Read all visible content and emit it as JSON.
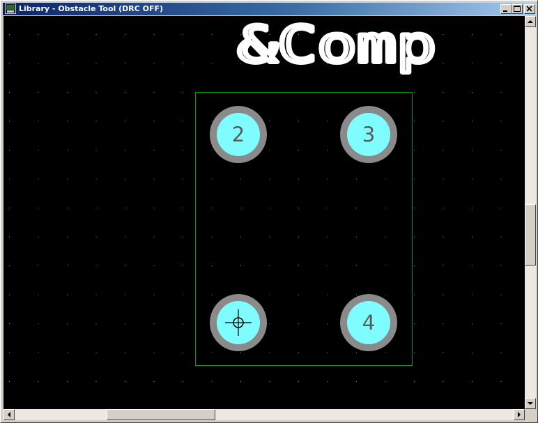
{
  "window": {
    "title": "Library - Obstacle Tool (DRC OFF)"
  },
  "canvas": {
    "colors": {
      "background": "#000000",
      "grid_dot": "#8a8a8a",
      "outline": "#00a000",
      "silkscreen": "#ffffff",
      "pad_fill": "#7ffcff",
      "pad_ring": "#8a8a8a",
      "pad_label": "#5a5a5a"
    },
    "ref_designator": "&Comp",
    "pads": [
      {
        "label": "2"
      },
      {
        "label": "3"
      },
      {
        "label": ""
      },
      {
        "label": "4"
      }
    ]
  },
  "icons": {
    "app": "library-icon",
    "minimize": "minimize-icon",
    "maximize": "maximize-icon",
    "close": "close-icon",
    "cursor": "crosshair-target-icon"
  },
  "scrollbars": {
    "vertical_position": 0.45,
    "horizontal_position": 0.25
  }
}
